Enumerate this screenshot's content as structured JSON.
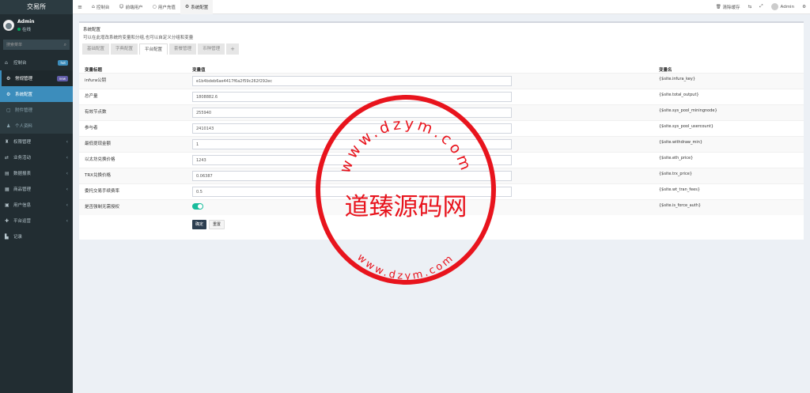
{
  "sidebar": {
    "brand": "交易所",
    "user": {
      "name": "Admin",
      "status": "在线"
    },
    "search_placeholder": "搜索菜单",
    "items": [
      {
        "icon": "dashboard-icon",
        "glyph": "⌂",
        "label": "控制台",
        "badge": "hot"
      },
      {
        "icon": "gear-icon",
        "glyph": "⚙",
        "label": "常规管理",
        "badge": "new"
      },
      {
        "icon": "user-group-icon",
        "glyph": "♜",
        "label": "权限管理"
      },
      {
        "icon": "transfer-icon",
        "glyph": "⇄",
        "label": "业务活动"
      },
      {
        "icon": "report-icon",
        "glyph": "▤",
        "label": "数据报表"
      },
      {
        "icon": "sales-icon",
        "glyph": "▦",
        "label": "商品管理"
      },
      {
        "icon": "users-icon",
        "glyph": "▣",
        "label": "用户信息"
      },
      {
        "icon": "platform-icon",
        "glyph": "✚",
        "label": "平台运营"
      },
      {
        "icon": "chart-icon",
        "glyph": "▙",
        "label": "记录"
      }
    ],
    "submenu": [
      {
        "icon": "settings-icon",
        "glyph": "⚙",
        "label": "系统配置"
      },
      {
        "icon": "file-icon",
        "glyph": "▢",
        "label": "附件管理"
      },
      {
        "icon": "person-icon",
        "glyph": "♟",
        "label": "个人资料"
      }
    ]
  },
  "topbar": {
    "tabs": [
      {
        "icon": "dashboard-icon",
        "glyph": "⌂",
        "label": "控制台"
      },
      {
        "icon": "user-icon",
        "glyph": "☺",
        "label": "前端用户"
      },
      {
        "icon": "recharge-icon",
        "glyph": "○",
        "label": "用户充值"
      },
      {
        "icon": "gear-icon",
        "glyph": "⚙",
        "label": "系统配置"
      }
    ],
    "clear_cache": "清除缓存",
    "user": "Admin"
  },
  "box": {
    "title": "系统配置",
    "description": "可以在此增改系统的变量和分组,也可以自定义分组和变量",
    "tabs": [
      "基础配置",
      "字典配置",
      "平台配置",
      "套餐管理",
      "币种管理"
    ]
  },
  "table": {
    "headers": {
      "label": "变量标题",
      "value": "变量值",
      "var": "变量名"
    },
    "rows": [
      {
        "label": "infura公钥",
        "value": "e1b4bdeb6ae4417f6a2f59c262f292ec",
        "var": "{$site.infura_key}"
      },
      {
        "label": "总产量",
        "value": "1808882.6",
        "var": "{$site.total_output}"
      },
      {
        "label": "有效节点数",
        "value": "255940",
        "var": "{$site.sys_pool_miningnode}"
      },
      {
        "label": "参与者",
        "value": "2410143",
        "var": "{$site.sys_pool_usercount}"
      },
      {
        "label": "最低提现金额",
        "value": "1",
        "var": "{$site.withdraw_min}"
      },
      {
        "label": "以太坊兑换价格",
        "value": "1243",
        "var": "{$site.eth_price}"
      },
      {
        "label": "TRX兑换价格",
        "value": "0.06387",
        "var": "{$site.trx_price}"
      },
      {
        "label": "委托交易手续费率",
        "value": "0.5",
        "var": "{$site.wt_tran_fees}"
      },
      {
        "label": "是否强制无需授权",
        "value": "on",
        "var": "{$site.is_force_auth}"
      }
    ]
  },
  "buttons": {
    "confirm": "确定",
    "reset": "重置"
  },
  "watermark": {
    "center": "道臻源码网",
    "top_arc": "www.dzym.com",
    "bottom_arc": "www.dzym.com",
    "color": "#e8141d"
  }
}
